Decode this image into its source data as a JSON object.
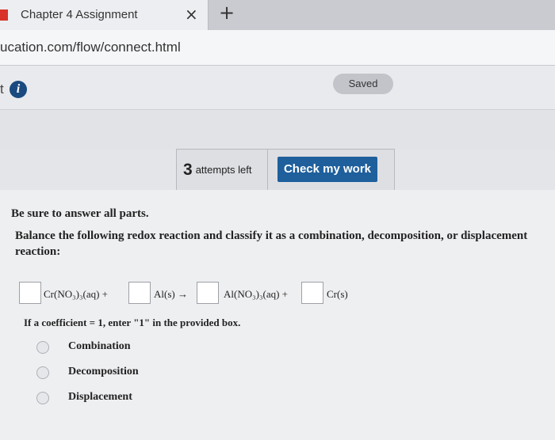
{
  "browser": {
    "tab_title": "Chapter 4 Assignment",
    "tab_close": "×",
    "new_tab": "+",
    "url": "ucation.com/flow/connect.html"
  },
  "header": {
    "partial_text": "t",
    "saved_label": "Saved"
  },
  "attempts": {
    "count": "3",
    "label": "attempts left",
    "check_label": "Check my work"
  },
  "question": {
    "instruction": "Be sure to answer all parts.",
    "prompt": "Balance the following redox reaction and classify it as a combination, decomposition, or displacement reaction:",
    "equation": {
      "term1": "Cr(NO₃)₃(aq) +",
      "term2": "Al(s) →",
      "term3": "Al(NO₃)₃(aq) +",
      "term4": "Cr(s)"
    },
    "note": "If a coefficient = 1, enter \"1\" in the provided box.",
    "options": [
      "Combination",
      "Decomposition",
      "Displacement"
    ]
  },
  "colors": {
    "check_button": "#1e5f9c",
    "info_icon": "#1a4a7f",
    "favicon": "#d8322a"
  }
}
